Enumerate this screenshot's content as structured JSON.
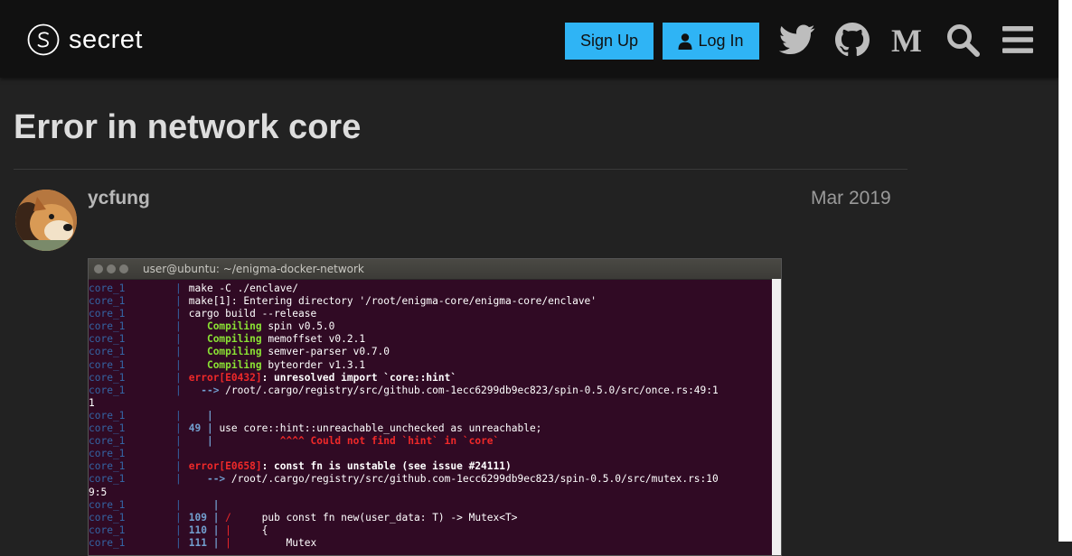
{
  "header": {
    "logo_text": "secret",
    "signup_label": "Sign Up",
    "login_label": "Log In",
    "icons": [
      "twitter-icon",
      "github-icon",
      "medium-icon",
      "search-icon",
      "hamburger-menu-icon"
    ],
    "accent_color": "#2fb4f5",
    "background_color": "#111111"
  },
  "topic": {
    "title": "Error in network core"
  },
  "post": {
    "username": "ycfung",
    "date": "Mar 2019",
    "avatar_icon": "dog-avatar",
    "terminal": {
      "title": "user@ubuntu: ~/enigma-docker-network",
      "lines": [
        {
          "label": "core_1",
          "bar": "|",
          "parts": [
            {
              "t": "make -C ./enclave/",
              "c": "ttext"
            }
          ]
        },
        {
          "label": "core_1",
          "bar": "|",
          "parts": [
            {
              "t": "make[1]: Entering directory '/root/enigma-core/enigma-core/enclave'",
              "c": "ttext"
            }
          ]
        },
        {
          "label": "core_1",
          "bar": "|",
          "parts": [
            {
              "t": "cargo build --release",
              "c": "ttext"
            }
          ]
        },
        {
          "label": "core_1",
          "bar": "|",
          "parts": [
            {
              "t": "   Compiling",
              "c": "tgreen"
            },
            {
              "t": " spin v0.5.0",
              "c": "ttext"
            }
          ]
        },
        {
          "label": "core_1",
          "bar": "|",
          "parts": [
            {
              "t": "   Compiling",
              "c": "tgreen"
            },
            {
              "t": " memoffset v0.2.1",
              "c": "ttext"
            }
          ]
        },
        {
          "label": "core_1",
          "bar": "|",
          "parts": [
            {
              "t": "   Compiling",
              "c": "tgreen"
            },
            {
              "t": " semver-parser v0.7.0",
              "c": "ttext"
            }
          ]
        },
        {
          "label": "core_1",
          "bar": "|",
          "parts": [
            {
              "t": "   Compiling",
              "c": "tgreen"
            },
            {
              "t": " byteorder v1.3.1",
              "c": "ttext"
            }
          ]
        },
        {
          "label": "core_1",
          "bar": "|",
          "parts": [
            {
              "t": "error[E0432]",
              "c": "tred"
            },
            {
              "t": ": unresolved import `core::hint`",
              "c": "tbold"
            }
          ]
        },
        {
          "label": "core_1",
          "bar": "|",
          "parts": [
            {
              "t": "  --> ",
              "c": "tblue"
            },
            {
              "t": "/root/.cargo/registry/src/github.com-1ecc6299db9ec823/spin-0.5.0/src/once.rs:49:1",
              "c": "ttext"
            }
          ]
        },
        {
          "label": "",
          "bar": "",
          "parts": [
            {
              "t": "1",
              "c": "tfull"
            }
          ]
        },
        {
          "label": "core_1",
          "bar": "|",
          "parts": [
            {
              "t": "   |",
              "c": "tblue"
            }
          ]
        },
        {
          "label": "core_1",
          "bar": "|",
          "parts": [
            {
              "t": "49 |",
              "c": "tblue"
            },
            {
              "t": " use core::hint::unreachable_unchecked as unreachable;",
              "c": "ttext"
            }
          ]
        },
        {
          "label": "core_1",
          "bar": "|",
          "parts": [
            {
              "t": "   |",
              "c": "tblue"
            },
            {
              "t": "           ^^^^ Could not find `hint` in `core`",
              "c": "tred"
            }
          ]
        },
        {
          "label": "core_1",
          "bar": "|",
          "parts": []
        },
        {
          "label": "core_1",
          "bar": "|",
          "parts": [
            {
              "t": "error[E0658]",
              "c": "tred"
            },
            {
              "t": ": const fn is unstable (see issue #24111)",
              "c": "tbold"
            }
          ]
        },
        {
          "label": "core_1",
          "bar": "|",
          "parts": [
            {
              "t": "   --> ",
              "c": "tblue"
            },
            {
              "t": "/root/.cargo/registry/src/github.com-1ecc6299db9ec823/spin-0.5.0/src/mutex.rs:10",
              "c": "ttext"
            }
          ]
        },
        {
          "label": "",
          "bar": "",
          "parts": [
            {
              "t": "9:5",
              "c": "tfull"
            }
          ]
        },
        {
          "label": "core_1",
          "bar": "|",
          "parts": [
            {
              "t": "    |",
              "c": "tblue"
            }
          ]
        },
        {
          "label": "core_1",
          "bar": "|",
          "parts": [
            {
              "t": "109 | ",
              "c": "tblue"
            },
            {
              "t": "/",
              "c": "tredn"
            },
            {
              "t": "     pub const fn new(user_data: T) -> Mutex<T>",
              "c": "ttext"
            }
          ]
        },
        {
          "label": "core_1",
          "bar": "|",
          "parts": [
            {
              "t": "110 | ",
              "c": "tblue"
            },
            {
              "t": "|",
              "c": "tredn"
            },
            {
              "t": "     {",
              "c": "ttext"
            }
          ]
        },
        {
          "label": "core_1",
          "bar": "|",
          "parts": [
            {
              "t": "111 | ",
              "c": "tblue"
            },
            {
              "t": "|",
              "c": "tredn"
            },
            {
              "t": "         Mutex",
              "c": "ttext"
            }
          ]
        }
      ]
    }
  }
}
